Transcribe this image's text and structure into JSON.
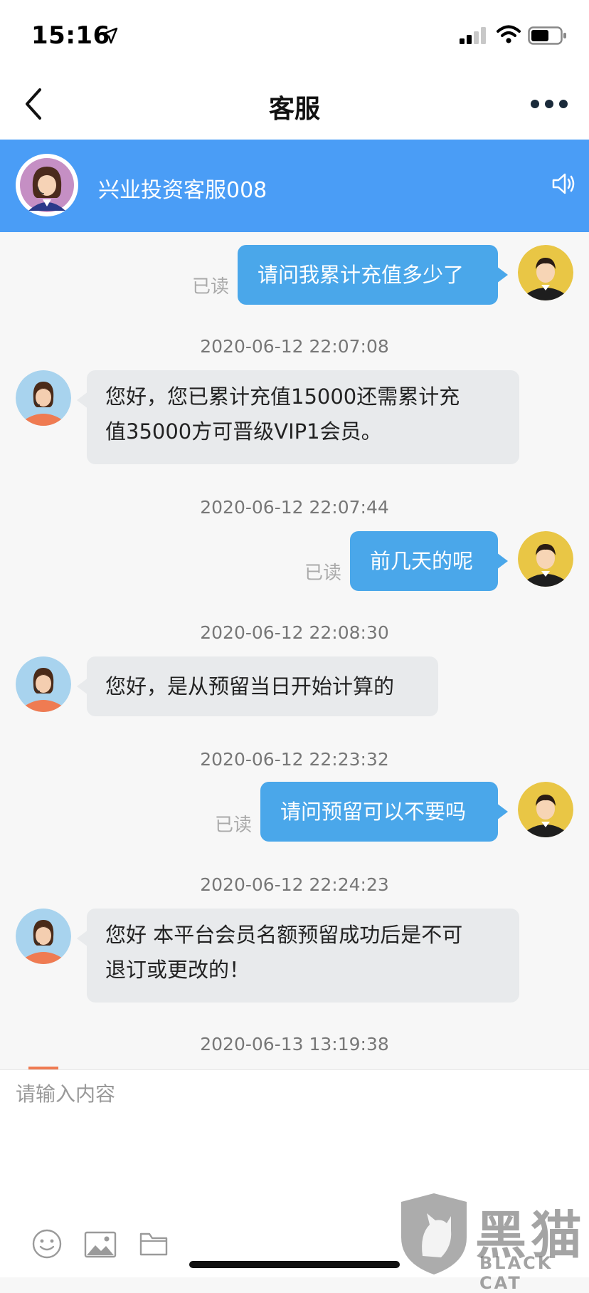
{
  "status_bar": {
    "time": "15:16"
  },
  "nav": {
    "title": "客服"
  },
  "agent": {
    "name": "兴业投资客服008"
  },
  "messages": [
    {
      "type": "outgoing",
      "text": "请问我累计充值多少了",
      "read": "已读"
    },
    {
      "type": "timestamp",
      "text": "2020-06-12 22:07:08"
    },
    {
      "type": "incoming",
      "line1": "您好，您已累计充值15000还需累计充",
      "line2": "值35000方可晋级VIP1会员。"
    },
    {
      "type": "timestamp",
      "text": "2020-06-12 22:07:44"
    },
    {
      "type": "outgoing",
      "text": "前几天的呢",
      "read": "已读"
    },
    {
      "type": "timestamp",
      "text": "2020-06-12 22:08:30"
    },
    {
      "type": "incoming",
      "text": "您好，是从预留当日开始计算的"
    },
    {
      "type": "timestamp",
      "text": "2020-06-12 22:23:32"
    },
    {
      "type": "outgoing",
      "text": "请问预留可以不要吗",
      "read": "已读"
    },
    {
      "type": "timestamp",
      "text": "2020-06-12 22:24:23"
    },
    {
      "type": "incoming",
      "line1": "您好 本平台会员名额预留成功后是不可",
      "line2": "退订或更改的！"
    },
    {
      "type": "timestamp",
      "text": "2020-06-13 13:19:38"
    }
  ],
  "input": {
    "placeholder": "请输入内容"
  },
  "toolbar": {
    "icons": [
      "emoji-icon",
      "image-icon",
      "folder-icon"
    ]
  },
  "watermark": {
    "name": "黑猫",
    "sub": "BLACK CAT"
  },
  "colors": {
    "header_blue": "#4a9df6",
    "outgoing_bubble": "#4aa7ea",
    "incoming_bubble": "#e8eaec"
  }
}
